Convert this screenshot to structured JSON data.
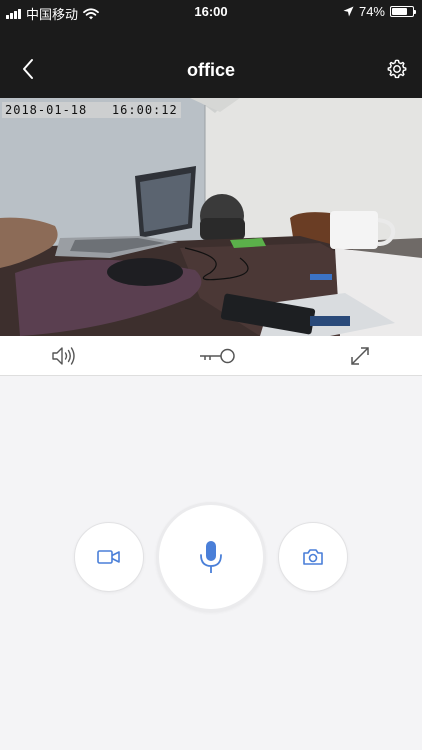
{
  "status_bar": {
    "carrier": "中国移动",
    "time": "16:00",
    "battery_text": "74%",
    "battery_level": 0.74
  },
  "nav": {
    "title": "office",
    "back_icon": "chevron-left-icon",
    "settings_icon": "gear-icon"
  },
  "camera": {
    "timestamp": "2018-01-18   16:00:12"
  },
  "controls": {
    "speaker_icon": "speaker-icon",
    "key_icon": "key-icon",
    "fullscreen_icon": "expand-icon"
  },
  "actions": {
    "record_icon": "video-camera-icon",
    "mic_icon": "microphone-icon",
    "snapshot_icon": "camera-icon",
    "accent_color": "#4a7fd8"
  }
}
